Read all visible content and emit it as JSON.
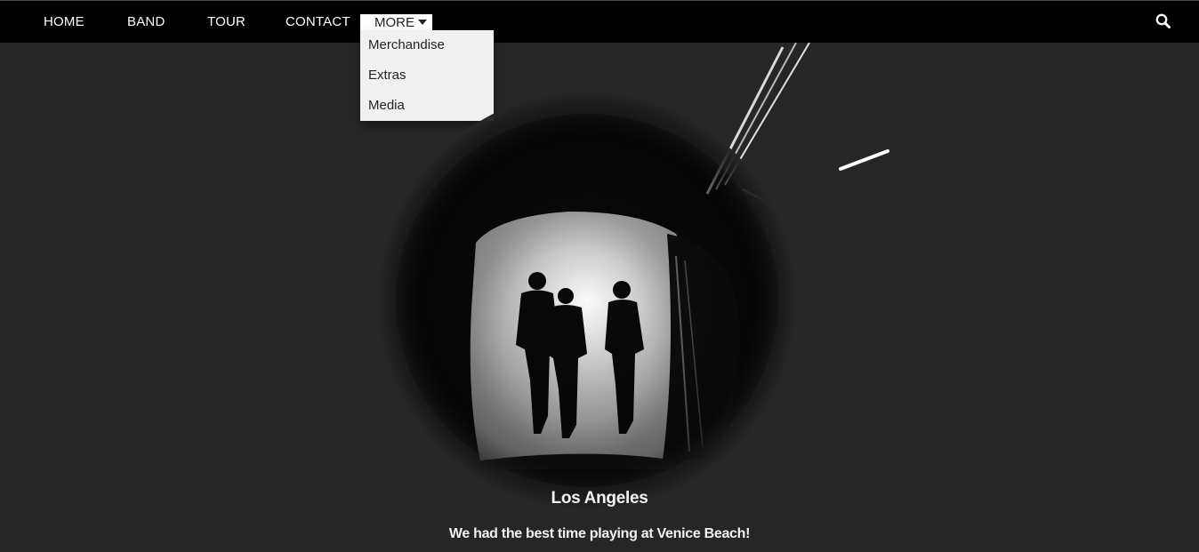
{
  "nav": {
    "items": [
      {
        "label": "HOME"
      },
      {
        "label": "BAND"
      },
      {
        "label": "TOUR"
      },
      {
        "label": "CONTACT"
      }
    ],
    "more_label": "MORE",
    "dropdown": [
      {
        "label": "Merchandise"
      },
      {
        "label": "Extras"
      },
      {
        "label": "Media"
      }
    ],
    "search_icon": "search-icon"
  },
  "hero": {
    "image_description_icon": "band-silhouette-photo",
    "city": "Los Angeles",
    "text": "We had the best time playing at Venice Beach!"
  },
  "colors": {
    "background": "#262626",
    "navbar": "#000000",
    "dropdown_bg": "#f1f1f1"
  }
}
